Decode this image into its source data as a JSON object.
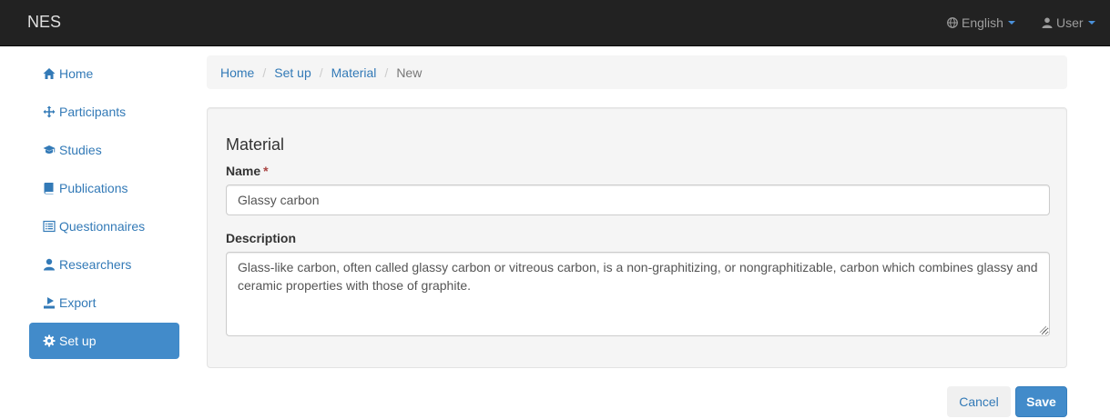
{
  "navbar": {
    "brand": "NES",
    "language_label": "English",
    "user_label": "User",
    "icons": {
      "language": "globe-icon",
      "user": "user-icon"
    }
  },
  "sidebar": {
    "items": [
      {
        "label": "Home",
        "icon": "home-icon",
        "active": false
      },
      {
        "label": "Participants",
        "icon": "move-icon",
        "active": false
      },
      {
        "label": "Studies",
        "icon": "graduation-cap-icon",
        "active": false
      },
      {
        "label": "Publications",
        "icon": "book-icon",
        "active": false
      },
      {
        "label": "Questionnaires",
        "icon": "list-alt-icon",
        "active": false
      },
      {
        "label": "Researchers",
        "icon": "user-icon",
        "active": false
      },
      {
        "label": "Export",
        "icon": "export-icon",
        "active": false
      },
      {
        "label": "Set up",
        "icon": "cog-icon",
        "active": true
      }
    ]
  },
  "breadcrumb": {
    "items": [
      "Home",
      "Set up",
      "Material"
    ],
    "current": "New",
    "separator": "/"
  },
  "form": {
    "section_title": "Material",
    "name_label": "Name",
    "required_mark": "*",
    "name_value": "Glassy carbon",
    "description_label": "Description",
    "description_value": "Glass-like carbon, often called glassy carbon or vitreous carbon, is a non-graphitizing, or nongraphitizable, carbon which combines glassy and ceramic properties with those of graphite."
  },
  "actions": {
    "cancel_label": "Cancel",
    "save_label": "Save"
  },
  "colors": {
    "navbar_bg": "#222222",
    "link": "#337ab7",
    "primary": "#428bca",
    "required": "#a94442"
  }
}
